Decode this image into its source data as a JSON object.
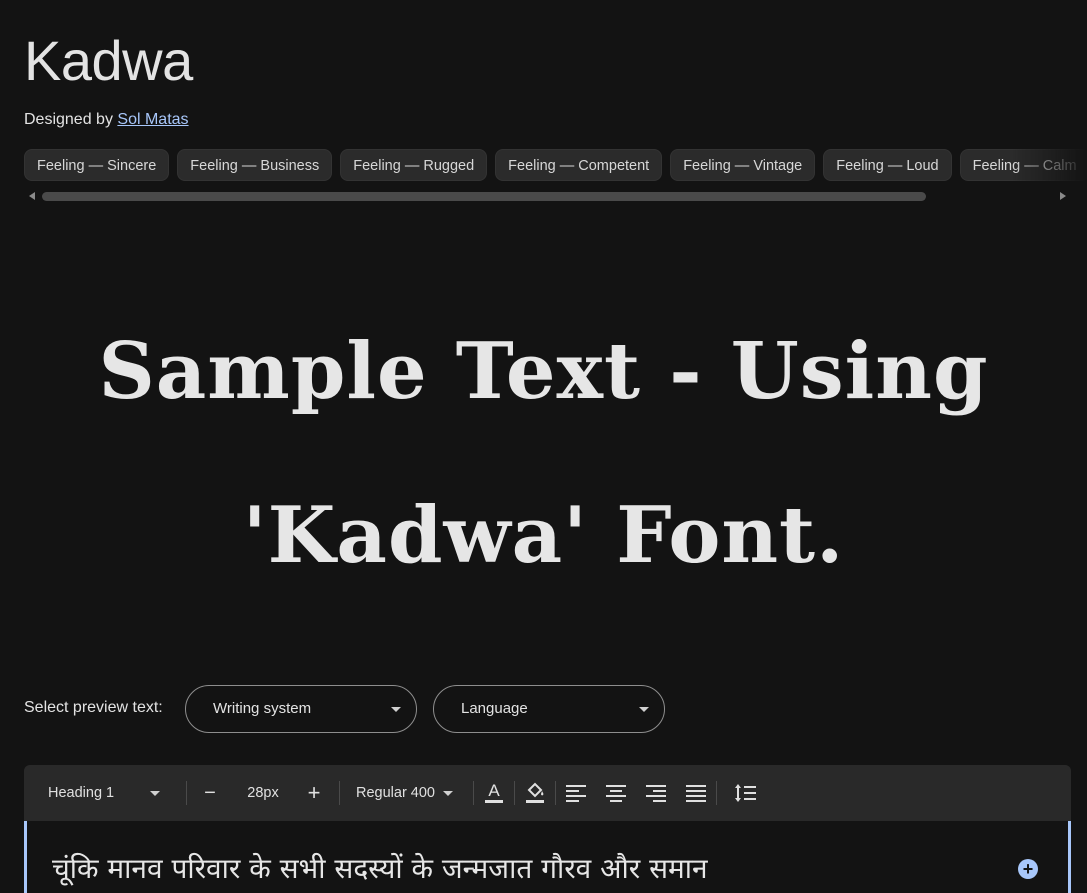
{
  "font": {
    "name": "Kadwa",
    "designed_by_prefix": "Designed by",
    "designer": "Sol Matas"
  },
  "tags": [
    {
      "label": "Feeling — Sincere"
    },
    {
      "label": "Feeling — Business"
    },
    {
      "label": "Feeling — Rugged"
    },
    {
      "label": "Feeling — Competent"
    },
    {
      "label": "Feeling — Vintage"
    },
    {
      "label": "Feeling — Loud"
    },
    {
      "label": "Feeling — Calm"
    }
  ],
  "sample": {
    "line1": "Sample Text - Using",
    "line2": "'Kadwa' Font."
  },
  "preview": {
    "label": "Select preview text:",
    "writing_system": "Writing system",
    "language": "Language"
  },
  "toolbar": {
    "style": "Heading 1",
    "minus": "−",
    "size": "28px",
    "plus": "+",
    "weight": "Regular 400"
  },
  "editor": {
    "text": "चूंकि मानव परिवार के सभी सदस्यों के जन्मजात गौरव और समान",
    "add": "+"
  },
  "colors": {
    "background": "#131313",
    "chip": "#2b2b2b",
    "link": "#a8c7fa",
    "accent": "#a8c7fa"
  },
  "icons": [
    "text-color-icon",
    "highlight-icon",
    "align-left-icon",
    "align-center-icon",
    "align-right-icon",
    "align-justify-icon",
    "line-height-icon",
    "add-circle-icon"
  ]
}
